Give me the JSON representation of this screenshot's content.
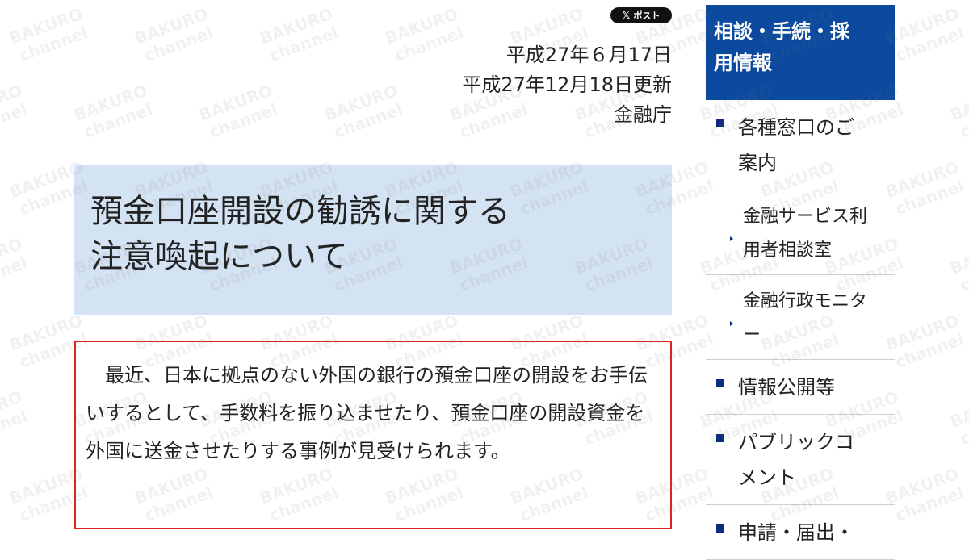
{
  "watermark": {
    "line1": "BAKURO",
    "line2": "channel"
  },
  "share": {
    "post_label": "ポスト",
    "x_glyph": "𝕏"
  },
  "dates": {
    "published": "平成27年６月17日",
    "updated": "平成27年12月18日更新",
    "agency": "金融庁"
  },
  "title": {
    "line1": "預金口座開設の勧誘に関する",
    "line2": "注意喚起について"
  },
  "notice": {
    "text": "最近、日本に拠点のない外国の銀行の預金口座の開設をお手伝いするとして、手数料を振り込ませたり、預金口座の開設資金を外国に送金させたりする事例が見受けられます。"
  },
  "sidebar": {
    "heading_line1": "相談・手続・採",
    "heading_line2": "用情報",
    "items": [
      {
        "line1": "各種窓口のご",
        "line2": "案内"
      },
      {
        "line1": "金融サービス利",
        "line2": "用者相談室"
      },
      {
        "line1": "金融行政モニタ",
        "line2": "ー"
      },
      {
        "line1": "情報公開等"
      },
      {
        "line1": "パブリックコ",
        "line2": "メント"
      },
      {
        "line1": "申請・届出・"
      }
    ]
  },
  "colors": {
    "sidebar_heading_bg": "#0b4a9e",
    "title_bg": "#d4e3f3",
    "notice_border": "#dd2222",
    "bullet": "#0b2b7e"
  }
}
